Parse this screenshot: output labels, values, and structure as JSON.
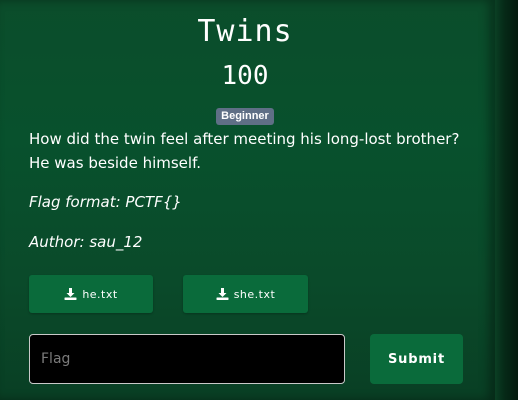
{
  "challenge": {
    "title": "Twins",
    "points": "100",
    "difficulty": "Beginner",
    "description": "How did the twin feel after meeting his long-lost brother? He was beside himself.",
    "flag_format": "Flag format: PCTF{}",
    "author": "Author: sau_12"
  },
  "files": [
    {
      "label": "he.txt",
      "icon": "download-icon"
    },
    {
      "label": "she.txt",
      "icon": "download-icon"
    }
  ],
  "submission": {
    "placeholder": "Flag",
    "value": "",
    "submit_label": "Submit"
  },
  "colors": {
    "panel_green": "#0b4d2b",
    "button_green": "#0a6b3b",
    "badge": "#5f6f86",
    "input_bg": "#000000"
  }
}
